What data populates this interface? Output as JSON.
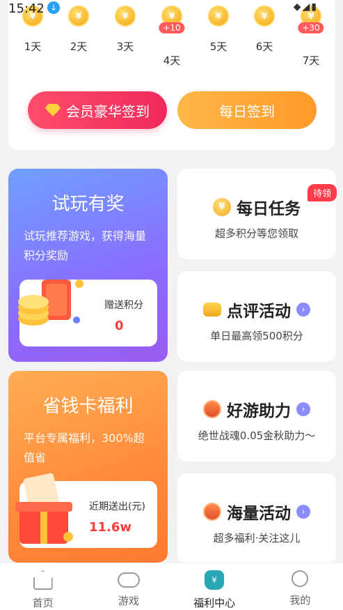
{
  "status_bar": {
    "time": "15:42"
  },
  "checkin": {
    "days": [
      {
        "label": "1天"
      },
      {
        "label": "2天"
      },
      {
        "label": "3天"
      },
      {
        "label": "4天",
        "bonus": "+10"
      },
      {
        "label": "5天"
      },
      {
        "label": "6天"
      },
      {
        "label": "7天",
        "bonus": "+30"
      }
    ],
    "coin_symbol": "¥",
    "vip_button": "会员豪华签到",
    "daily_button": "每日签到"
  },
  "trial_card": {
    "title": "试玩有奖",
    "description": "试玩推荐游戏，获得海量积分奖励",
    "stat_label": "赠送积分",
    "stat_value": "0"
  },
  "save_card": {
    "title": "省钱卡福利",
    "description": "平台专属福利，300%超值省",
    "stat_label": "近期送出(元)",
    "stat_value": "11.6w"
  },
  "tasks": [
    {
      "title": "每日任务",
      "subtitle": "超多积分等您领取",
      "badge": "待领",
      "icon": "coin-icon"
    },
    {
      "title": "点评活动",
      "subtitle": "单日最高领500积分",
      "icon": "coin-stack-icon"
    },
    {
      "title": "好游助力",
      "subtitle": "绝世战魂0.05金秋助力～",
      "icon": "treasure-chest-icon"
    },
    {
      "title": "海量活动",
      "subtitle": "超多福利·关注这儿",
      "icon": "treasure-chest-icon"
    }
  ],
  "bottom_nav": [
    {
      "label": "首页",
      "icon": "home-icon"
    },
    {
      "label": "游戏",
      "icon": "gamepad-icon"
    },
    {
      "label": "福利中心",
      "icon": "welfare-bag-icon",
      "active": true
    },
    {
      "label": "我的",
      "icon": "user-icon"
    }
  ]
}
